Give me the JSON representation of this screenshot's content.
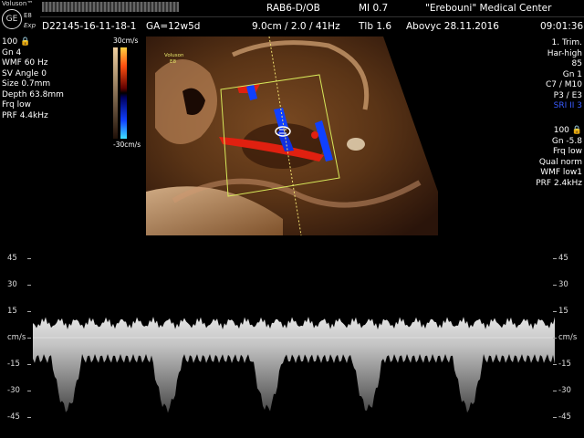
{
  "header": {
    "brand": "Voluson™",
    "model": "E8",
    "mode": "Exp",
    "logo_text": "GE",
    "probe": "RAB6-D/OB",
    "mi": "MI  0.7",
    "institution": "\"Erebouni\" Medical Center",
    "patient_id": "D22145-16-11-18-1",
    "ga": "GA=12w5d",
    "depth_freq": "9.0cm / 2.0 / 41Hz",
    "tib": "Tlb  1.6",
    "operator_date": "Abovyc  28.11.2016",
    "time": "09:01:36"
  },
  "left_params": {
    "power": "100",
    "gn": "Gn   4",
    "wmf": "WMF 60 Hz",
    "sv_angle": "SV Angle  0",
    "size": "Size  0.7mm",
    "depth": "Depth 63.8mm",
    "frq": "Frq low",
    "prf": "PRF  4.4kHz"
  },
  "color_scale": {
    "top": "30cm/s",
    "bottom": "-30cm/s"
  },
  "image_label": {
    "brand": "Voluson",
    "model": "E8"
  },
  "right_params_top": {
    "trim": "1. Trim.",
    "har": "Har-high",
    "val": "85",
    "gn": "Gn   1",
    "c7": "C7 / M10",
    "p3": "P3 / E3",
    "sri": "SRI II 3"
  },
  "right_params_bottom": {
    "power": "100",
    "gn": "Gn -5.8",
    "frq": "Frq low",
    "qual": "Qual norm",
    "wmf": "WMF low1",
    "prf": "PRF  2.4kHz"
  },
  "doppler_axis": {
    "labels_left": [
      "45",
      "30",
      "15",
      "cm/s",
      "-15",
      "-30",
      "-45"
    ],
    "labels_right": [
      "45",
      "30",
      "15",
      "cm/s",
      "-15",
      "-30",
      "-45"
    ]
  },
  "colors": {
    "accent_blue": "#3a5cff",
    "roi_yellow": "#d7e85a",
    "doppler_red": "#e02010",
    "doppler_blue": "#1040ff"
  }
}
